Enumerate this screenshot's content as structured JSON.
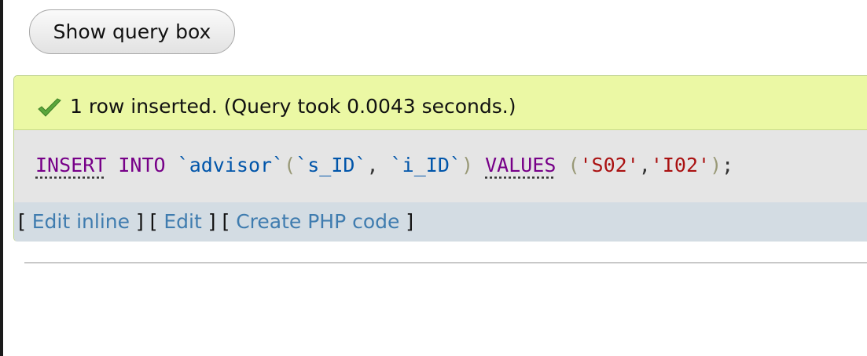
{
  "toolbar": {
    "show_query_box_label": "Show query box"
  },
  "result": {
    "message": "1 row inserted. (Query took 0.0043 seconds.)",
    "icon": "checkmark-icon",
    "colors": {
      "success_bg": "#ebf8a4",
      "sql_bg": "#e5e5e5",
      "links_bg": "#d3dce3",
      "link": "#3f7caf",
      "keyword": "#770088",
      "identifier": "#0055aa",
      "string": "#aa1111"
    }
  },
  "sql": {
    "insert": "INSERT",
    "into": "INTO",
    "table": "`advisor`",
    "open_paren": "(",
    "col1": "`s_ID`",
    "comma": ",",
    "col2": "`i_ID`",
    "close_paren": ")",
    "values": "VALUES",
    "val1": "'S02'",
    "val2": "'I02'",
    "end": ";"
  },
  "actions": {
    "bracket_open": "[",
    "bracket_close": "]",
    "edit_inline": "Edit inline",
    "edit": "Edit",
    "create_php_code": "Create PHP code"
  }
}
